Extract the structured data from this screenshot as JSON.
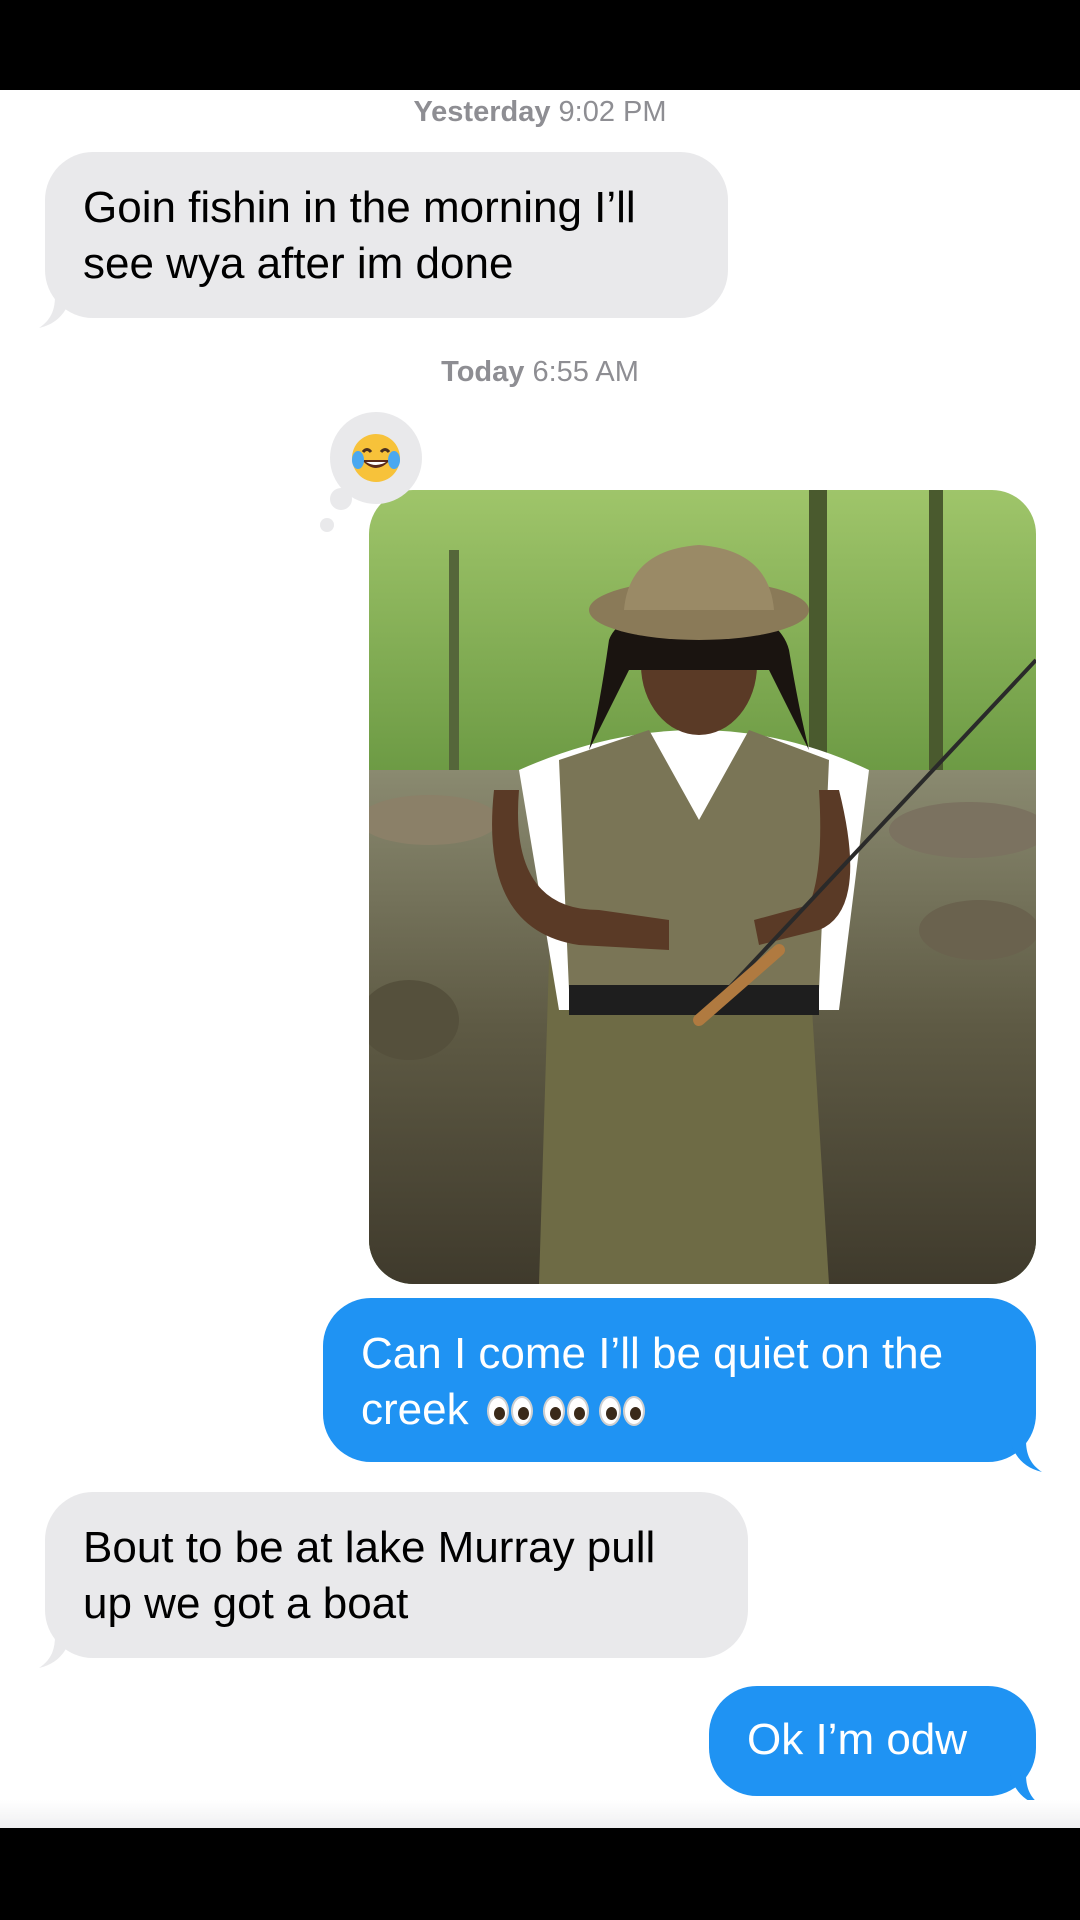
{
  "conversation": {
    "timestamp_1": {
      "day": "Yesterday",
      "time": "9:02 PM"
    },
    "timestamp_2": {
      "day": "Today",
      "time": "6:55 AM"
    },
    "messages": [
      {
        "direction": "incoming",
        "text": "Goin fishin in the morning I’ll see wya after im done"
      },
      {
        "direction": "outgoing",
        "type": "image",
        "reaction": "😂"
      },
      {
        "direction": "outgoing",
        "text": "Can I come I’ll be quiet on the creek",
        "emoji": "👀👀👀"
      },
      {
        "direction": "incoming",
        "text": "Bout to be at lake Murray pull up we got a boat"
      },
      {
        "direction": "outgoing",
        "text": "Ok I’m odw"
      }
    ]
  },
  "colors": {
    "incoming_bubble": "#e9e9eb",
    "outgoing_bubble": "#1f93f3",
    "timestamp": "#8e8e93"
  },
  "icons": {
    "reaction": "laughing-tears-emoji",
    "eyes": "eyes-emoji"
  }
}
